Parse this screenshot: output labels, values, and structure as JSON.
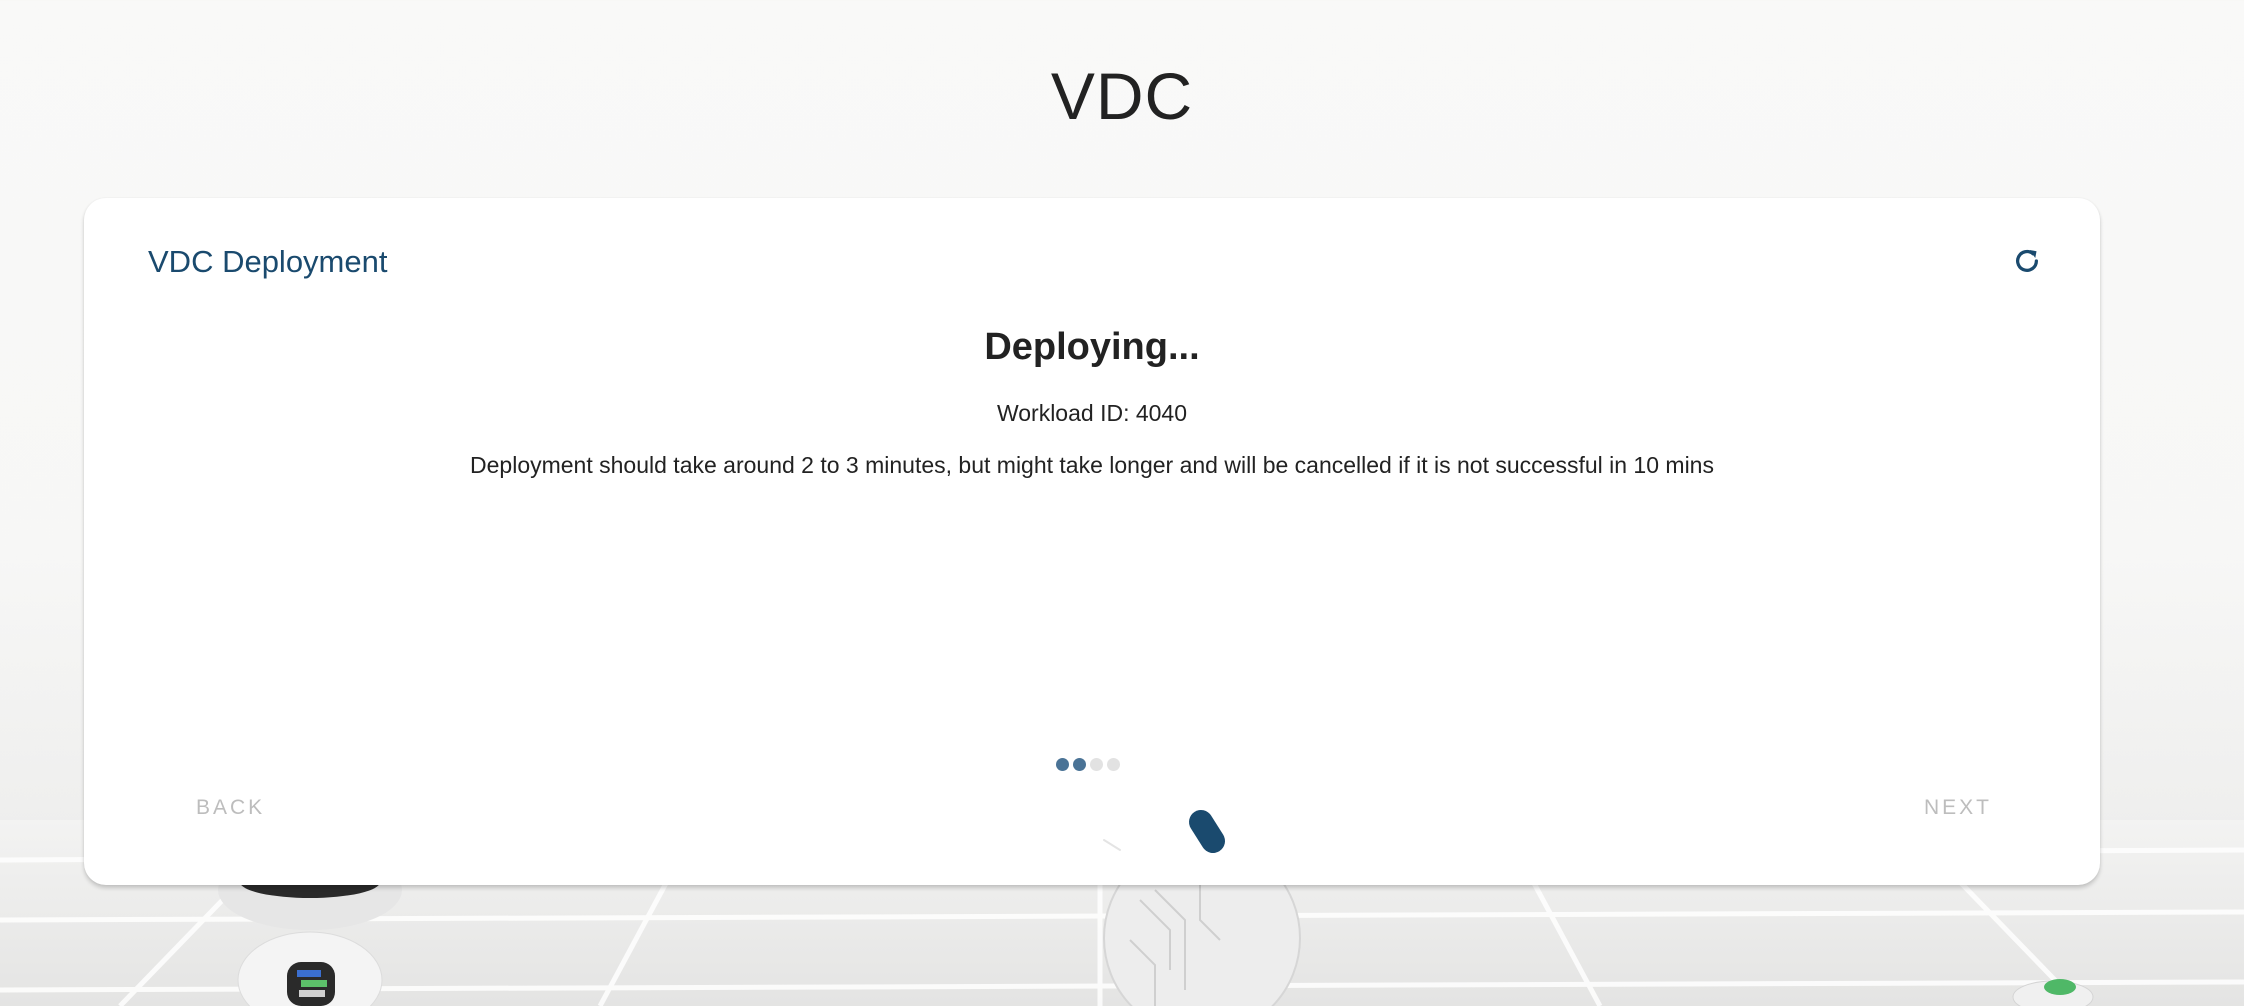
{
  "page": {
    "title": "VDC"
  },
  "card": {
    "title": "VDC Deployment",
    "refresh_icon": "refresh-icon",
    "status_title": "Deploying...",
    "workload_id": "Workload ID: 4040",
    "message": "Deployment should take around 2 to 3 minutes, but might take longer and will be cancelled if it is not successful in 10 mins",
    "steps": {
      "total": 4,
      "active": [
        true,
        true,
        false,
        false
      ]
    },
    "back_label": "BACK",
    "next_label": "NEXT"
  },
  "colors": {
    "accent": "#1a4a6e",
    "dot_active": "#4a7396",
    "dot_inactive": "#e2e2e2",
    "disabled_text": "#bdbdbd"
  }
}
